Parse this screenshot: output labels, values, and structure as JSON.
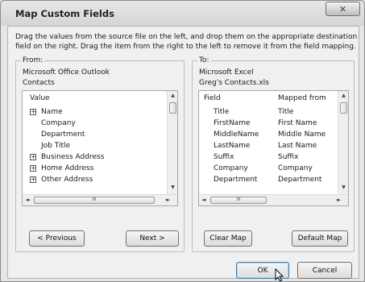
{
  "dialog": {
    "title": "Map Custom Fields",
    "close_glyph": "✕",
    "description": "Drag the values from the source file on the left, and drop them on the appropriate destination field on the right.  Drag the item from the right to the left to remove it from the field mapping."
  },
  "from": {
    "label": "From:",
    "source_app": "Microsoft Office Outlook",
    "source_folder": "Contacts",
    "column_header": "Value",
    "items": [
      {
        "label": "Name",
        "expandable": true
      },
      {
        "label": "Company",
        "expandable": false
      },
      {
        "label": "Department",
        "expandable": false
      },
      {
        "label": "Job Title",
        "expandable": false
      },
      {
        "label": "Business Address",
        "expandable": true
      },
      {
        "label": "Home Address",
        "expandable": true
      },
      {
        "label": "Other Address",
        "expandable": true
      }
    ],
    "previous_button": "< Previous",
    "next_button": "Next >"
  },
  "to": {
    "label": "To:",
    "target_app": "Microsoft Excel",
    "target_file": "Greg's Contacts.xls",
    "columns": [
      "Field",
      "Mapped from"
    ],
    "rows": [
      {
        "field": "Title",
        "mapped_from": "Title"
      },
      {
        "field": "FirstName",
        "mapped_from": "First Name"
      },
      {
        "field": "MiddleName",
        "mapped_from": "Middle Name"
      },
      {
        "field": "LastName",
        "mapped_from": "Last Name"
      },
      {
        "field": "Suffix",
        "mapped_from": "Suffix"
      },
      {
        "field": "Company",
        "mapped_from": "Company"
      },
      {
        "field": "Department",
        "mapped_from": "Department"
      }
    ],
    "clear_map_button": "Clear Map",
    "default_map_button": "Default Map"
  },
  "footer": {
    "ok_button": "OK",
    "cancel_button": "Cancel"
  },
  "scroll_glyphs": {
    "up": "▲",
    "down": "▼",
    "left": "◄",
    "right": "►",
    "grip": "III"
  }
}
